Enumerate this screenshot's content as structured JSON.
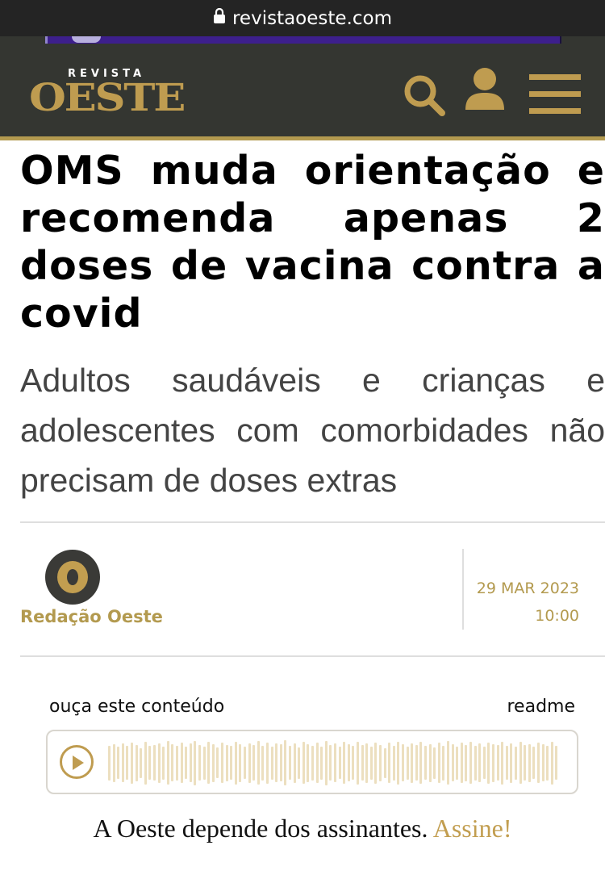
{
  "browser": {
    "url": "revistaoeste.com"
  },
  "header": {
    "logo_top": "REVISTA",
    "logo_main": "OESTE"
  },
  "article": {
    "headline": "OMS muda orientação e recomenda apenas 2 doses de vacina contra a covid",
    "subheadline": "Adultos saudáveis e crianças e adolescentes com comorbidades não precisam de doses extras",
    "author": "Redação Oeste",
    "date": "29 MAR 2023",
    "time": "10:00"
  },
  "audio": {
    "listen_label": "ouça este conteúdo",
    "provider": "readme",
    "progress": 0,
    "waveform_levels": [
      0.72,
      0.78,
      0.66,
      0.8,
      0.7,
      0.85,
      0.75,
      0.62,
      0.88,
      0.7,
      0.74,
      0.82,
      0.68,
      0.9,
      0.77,
      0.71,
      0.84,
      0.66,
      0.8,
      0.92,
      0.73,
      0.69,
      0.86,
      0.78,
      0.64,
      0.83,
      0.75,
      0.7,
      0.88,
      0.79,
      0.67,
      0.81,
      0.74,
      0.9,
      0.72,
      0.85,
      0.68,
      0.8,
      0.76,
      0.93,
      0.7,
      0.82,
      0.65,
      0.87,
      0.78,
      0.72,
      0.84,
      0.69,
      0.91,
      0.74,
      0.8,
      0.66,
      0.86,
      0.77,
      0.7,
      0.89,
      0.73,
      0.81,
      0.68,
      0.85,
      0.75,
      0.62,
      0.83,
      0.71,
      0.88,
      0.76,
      0.69,
      0.82,
      0.74,
      0.86,
      0.7,
      0.79,
      0.65,
      0.84,
      0.72,
      0.9,
      0.77,
      0.68,
      0.83,
      0.75,
      0.87,
      0.71,
      0.8,
      0.66,
      0.85,
      0.78,
      0.73,
      0.89,
      0.7,
      0.82,
      0.68,
      0.86,
      0.74,
      0.79,
      0.67,
      0.84,
      0.76,
      0.72,
      0.88,
      0.7
    ],
    "colors": {
      "accent": "#bf9c50",
      "wave": "#ecdfbf"
    }
  },
  "footer": {
    "message": "A Oeste depende dos assinantes.",
    "cta": "Assine!"
  },
  "icons": [
    "lock-icon",
    "search-icon",
    "user-icon",
    "hamburger-menu-icon",
    "play-icon"
  ],
  "colors": {
    "brand_gold": "#bf9c50",
    "header_bg": "#343631",
    "topbar_bg": "#242424"
  }
}
